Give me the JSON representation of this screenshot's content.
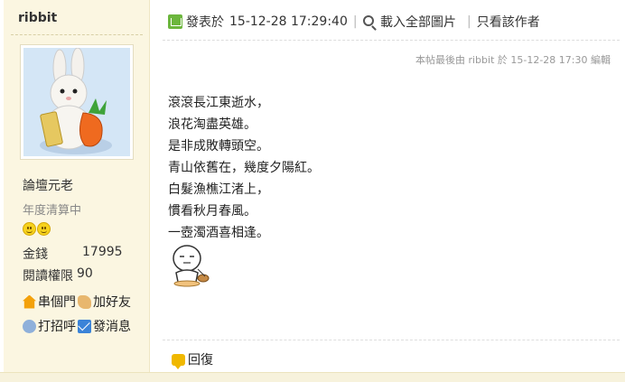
{
  "author": {
    "username": "ribbit",
    "title": "論壇元老",
    "status": "年度清算中",
    "money_label": "金錢",
    "money_value": "17995",
    "read_label": "閱讀權限",
    "read_value": "90",
    "actions": {
      "visit": "串個門",
      "add_friend": "加好友",
      "greet": "打招呼",
      "message": "發消息"
    }
  },
  "post": {
    "posted_prefix": "發表於",
    "posted_time": "15-12-28 17:29:40",
    "load_images": "載入全部圖片",
    "only_author": "只看該作者",
    "edit_note": "本帖最後由 ribbit 於 15-12-28 17:30 編輯",
    "lines": [
      "滾滾長江東逝水，",
      "浪花淘盡英雄。",
      "是非成敗轉頭空。",
      "青山依舊在，幾度夕陽紅。",
      "白髮漁樵江渚上，",
      "慣看秋月春風。",
      "一壺濁酒喜相逢。"
    ],
    "reply_label": "回復"
  },
  "icons": {
    "post_icon": "post-icon",
    "search": "search-icon",
    "home": "home-icon",
    "handshake": "handshake-icon",
    "greet": "greet-icon",
    "mail": "mail-icon",
    "reply": "reply-icon"
  },
  "colors": {
    "sidebar_bg": "#fbf6e1",
    "accent_green": "#6cb63d"
  }
}
